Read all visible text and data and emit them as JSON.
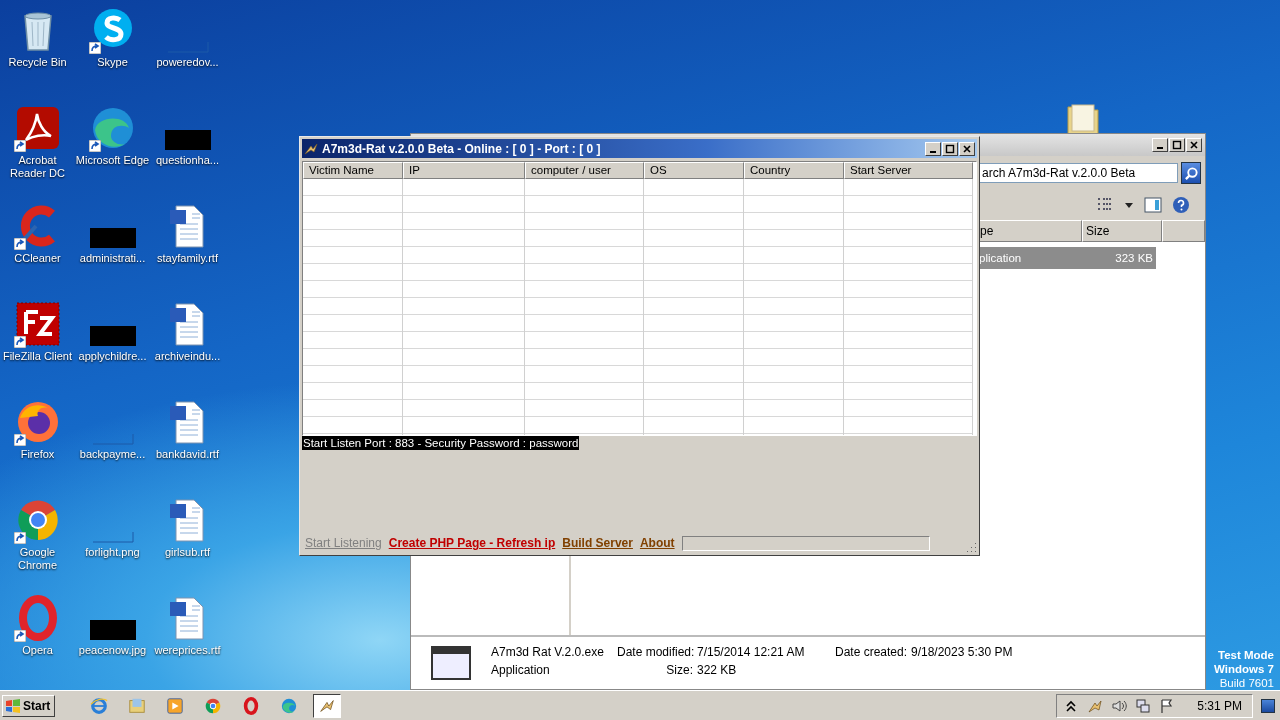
{
  "desktop": {
    "icons": [
      {
        "label": "Recycle Bin",
        "kind": "recycle",
        "shortcut": false
      },
      {
        "label": "Acrobat Reader DC",
        "kind": "acrobat",
        "shortcut": true
      },
      {
        "label": "CCleaner",
        "kind": "ccleaner",
        "shortcut": true
      },
      {
        "label": "FileZilla Client",
        "kind": "filezilla",
        "shortcut": true
      },
      {
        "label": "Firefox",
        "kind": "firefox",
        "shortcut": true
      },
      {
        "label": "Google Chrome",
        "kind": "chrome",
        "shortcut": true
      },
      {
        "label": "Opera",
        "kind": "opera",
        "shortcut": true
      },
      {
        "label": "Skype",
        "kind": "skype",
        "shortcut": true
      },
      {
        "label": "Microsoft Edge",
        "kind": "edge",
        "shortcut": true
      },
      {
        "label": "administrati...",
        "kind": "redacted",
        "shortcut": false
      },
      {
        "label": "applychildre...",
        "kind": "redacted",
        "shortcut": false
      },
      {
        "label": "backpayme...",
        "kind": "blank",
        "shortcut": false
      },
      {
        "label": "forlight.png",
        "kind": "blank",
        "shortcut": false
      },
      {
        "label": "peacenow.jpg",
        "kind": "redacted",
        "shortcut": false
      },
      {
        "label": "poweredov...",
        "kind": "blank",
        "shortcut": false
      },
      {
        "label": "questionha...",
        "kind": "redacted",
        "shortcut": false
      },
      {
        "label": "stayfamily.rtf",
        "kind": "word",
        "shortcut": false
      },
      {
        "label": "archiveindu...",
        "kind": "word",
        "shortcut": false
      },
      {
        "label": "bankdavid.rtf",
        "kind": "word",
        "shortcut": false
      },
      {
        "label": "girlsub.rtf",
        "kind": "word",
        "shortcut": false
      },
      {
        "label": "wereprices.rtf",
        "kind": "word",
        "shortcut": false
      }
    ],
    "test_mode": [
      "Test Mode",
      "Windows 7",
      "Build 7601"
    ]
  },
  "explorer": {
    "search": {
      "value": "arch A7m3d-Rat v.2.0.0 Beta"
    },
    "columns": [
      "pe",
      "Size"
    ],
    "rows": [
      {
        "cells": [
          "plication",
          "323 KB"
        ],
        "selected": true
      }
    ],
    "details": {
      "name": "A7m3d Rat V.2.0.exe",
      "type": "Application",
      "fields": [
        {
          "label": "Date modified:",
          "value": "7/15/2014 12:21 AM"
        },
        {
          "label": "Size:",
          "value": "322 KB"
        },
        {
          "label": "Date created:",
          "value": "9/18/2023 5:30 PM"
        }
      ]
    }
  },
  "rat_window": {
    "title": "A7m3d-Rat v.2.0.0 Beta - Online : [ 0 ] - Port : [ 0 ]",
    "columns": [
      "Victim Name",
      "IP",
      "computer / user",
      "OS",
      "Country",
      "Start Server"
    ],
    "status": "Start Listen Port : 883 - Security Password : password",
    "links": [
      {
        "label": "Start Listening",
        "disabled": true,
        "color": "#808080"
      },
      {
        "label": "Create PHP Page - Refresh ip",
        "disabled": false,
        "color": "#c00000"
      },
      {
        "label": "Build Server",
        "disabled": false,
        "color": "#804000"
      },
      {
        "label": "About",
        "disabled": false,
        "color": "#804000"
      }
    ]
  },
  "taskbar": {
    "start": "Start",
    "items": [
      {
        "kind": "ie",
        "selected": false
      },
      {
        "kind": "folder",
        "selected": false
      },
      {
        "kind": "media",
        "selected": false
      },
      {
        "kind": "chrome",
        "selected": false
      },
      {
        "kind": "opera",
        "selected": false
      },
      {
        "kind": "edge",
        "selected": false
      },
      {
        "kind": "rat",
        "selected": true
      }
    ],
    "tray": [
      {
        "kind": "chevron"
      },
      {
        "kind": "rat"
      },
      {
        "kind": "speaker"
      },
      {
        "kind": "network"
      },
      {
        "kind": "flag"
      }
    ],
    "clock": "5:31 PM"
  }
}
